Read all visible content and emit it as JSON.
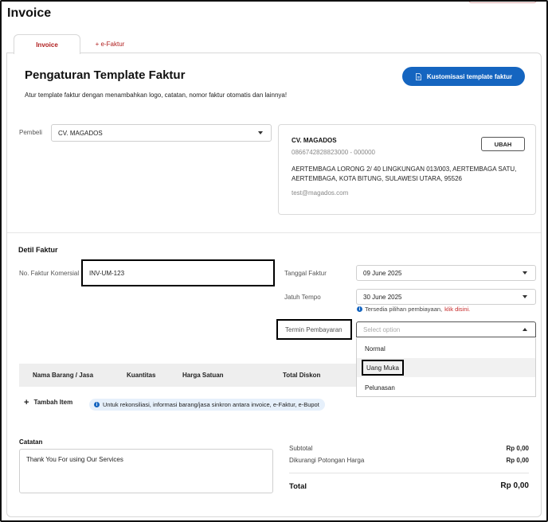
{
  "page": {
    "title": "Invoice"
  },
  "tabs": [
    {
      "label": "Invoice",
      "active": true
    },
    {
      "label": "+ e-Faktur",
      "active": false
    }
  ],
  "template": {
    "heading": "Pengaturan Template Faktur",
    "subheading": "Atur template faktur dengan menambahkan logo, catatan, nomor faktur otomatis dan lainnya!",
    "customize_button": "Kustomisasi template faktur"
  },
  "buyer": {
    "label": "Pembeli",
    "selected": "CV. MAGADOS",
    "card": {
      "name": "CV. MAGADOS",
      "npwp": "0866742828823000 - 000000",
      "address": "AERTEMBAGA LORONG 2/ 40 LINGKUNGAN 013/003, AERTEMBAGA SATU, AERTEMBAGA, KOTA BITUNG, SULAWESI UTARA, 95526",
      "email": "test@magados.com",
      "change_button": "UBAH"
    }
  },
  "invoice_detail": {
    "title": "Detil Faktur",
    "commercial_no_label": "No. Faktur Komersial",
    "commercial_no_value": "INV-UM-123",
    "invoice_date_label": "Tanggal Faktur",
    "invoice_date_value": "09 June 2025",
    "due_date_label": "Jatuh Tempo",
    "due_date_value": "30 June 2025",
    "hint_text": "Tersedia pilihan pembiayaan,",
    "hint_link": "klik disini.",
    "payment_term_label": "Termin Pembayaran",
    "payment_term_placeholder": "Select option",
    "payment_term_options": [
      "Normal",
      "Uang Muka",
      "Pelunasan"
    ]
  },
  "items_table": {
    "columns": [
      "Nama Barang / Jasa",
      "Kuantitas",
      "Harga Satuan",
      "Total Diskon"
    ],
    "add_item_label": "Tambah Item",
    "info_text": "Untuk rekonsiliasi, informasi barang/jasa sinkron antara invoice, e-Faktur, e-Bupot"
  },
  "notes": {
    "label": "Catatan",
    "value": "Thank You For using Our Services"
  },
  "summary": {
    "subtotal_label": "Subtotal",
    "subtotal_value": "Rp 0,00",
    "discount_label": "Dikurangi Potongan Harga",
    "discount_value": "Rp 0,00",
    "total_label": "Total",
    "total_value": "Rp 0,00"
  },
  "colors": {
    "primary": "#1565c0",
    "accent_red": "#b01e1e",
    "link_red": "#c62828"
  }
}
